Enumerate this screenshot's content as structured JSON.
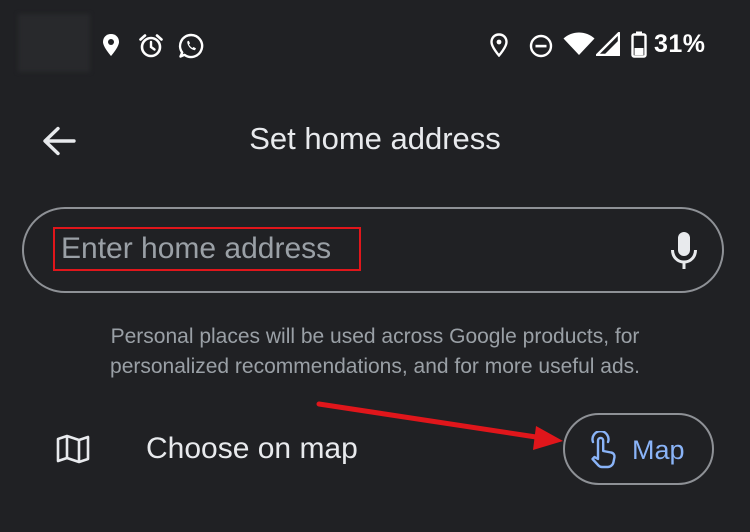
{
  "status_bar": {
    "left_icons": [
      "location-icon",
      "alarm-icon",
      "whatsapp-icon"
    ],
    "right_icons": [
      "location-icon",
      "do-not-disturb-icon",
      "wifi-icon",
      "signal-icon",
      "battery-icon"
    ],
    "battery_percent": "31%"
  },
  "header": {
    "title": "Set home address",
    "back_icon": "back-arrow-icon"
  },
  "search": {
    "placeholder": "Enter home address",
    "value": "",
    "mic_icon": "microphone-icon"
  },
  "disclaimer": {
    "line1": "Personal places will be used across Google products, for",
    "line2": "personalized recommendations, and for more useful ads."
  },
  "choose_on_map": {
    "label": "Choose on map",
    "icon": "map-icon"
  },
  "map_button": {
    "label": "Map",
    "icon": "touch-icon"
  },
  "colors": {
    "background": "#202124",
    "text": "#e8eaed",
    "secondary_text": "#9aa0a6",
    "outline": "#8e9196",
    "accent": "#8ab4f8",
    "annotation": "#e0161b"
  }
}
